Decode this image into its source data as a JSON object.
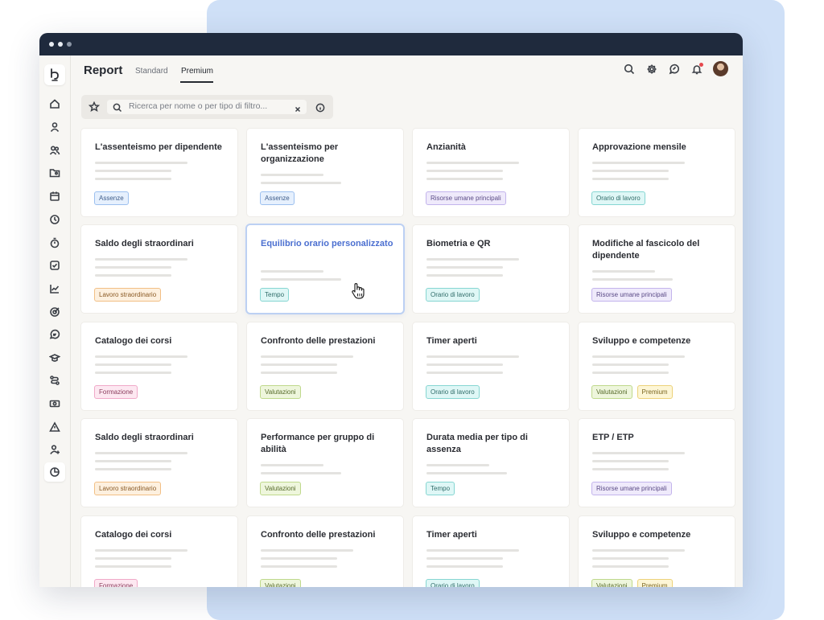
{
  "header": {
    "title": "Report",
    "tabs": [
      {
        "label": "Standard",
        "active": false
      },
      {
        "label": "Premium",
        "active": true
      }
    ]
  },
  "search": {
    "placeholder": "Ricerca per nome o per tipo di filtro..."
  },
  "icons": {
    "header": [
      "search-icon",
      "gear-icon",
      "chat-icon",
      "bell-icon"
    ],
    "sidebar": [
      "home-icon",
      "user-icon",
      "users-icon",
      "folder-user-icon",
      "calendar-icon",
      "clock-icon",
      "stopwatch-icon",
      "check-square-icon",
      "chart-icon",
      "target-icon",
      "chat-bubble-icon",
      "graduation-icon",
      "route-icon",
      "money-icon",
      "alert-icon",
      "user-plus-icon",
      "pie-chart-icon"
    ]
  },
  "colors": {
    "titlebar": "#1f2a3d",
    "background_panel": "#cfe0f7",
    "selected_title": "#4b6fd0"
  },
  "cards": [
    {
      "title": "L'assenteismo per dipendente",
      "tags": [
        {
          "label": "Assenze",
          "color": "blue"
        }
      ]
    },
    {
      "title": "L'assenteismo per organizzazione",
      "tags": [
        {
          "label": "Assenze",
          "color": "blue"
        }
      ]
    },
    {
      "title": "Anzianità",
      "tags": [
        {
          "label": "Risorse umane principali",
          "color": "purple"
        }
      ]
    },
    {
      "title": "Approvazione mensile",
      "tags": [
        {
          "label": "Orario di lavoro",
          "color": "teal"
        }
      ]
    },
    {
      "title": "Saldo degli straordinari",
      "tags": [
        {
          "label": "Lavoro straordinario",
          "color": "orange"
        }
      ]
    },
    {
      "title": "Equilibrio orario personalizzato",
      "tags": [
        {
          "label": "Tempo",
          "color": "teal"
        }
      ],
      "selected": true
    },
    {
      "title": "Biometria e QR",
      "tags": [
        {
          "label": "Orario di lavoro",
          "color": "teal"
        }
      ]
    },
    {
      "title": "Modifiche al fascicolo del dipendente",
      "tags": [
        {
          "label": "Risorse umane principali",
          "color": "purple"
        }
      ]
    },
    {
      "title": "Catalogo dei corsi",
      "tags": [
        {
          "label": "Formazione",
          "color": "pink"
        }
      ]
    },
    {
      "title": "Confronto delle prestazioni",
      "tags": [
        {
          "label": "Valutazioni",
          "color": "green"
        }
      ]
    },
    {
      "title": "Timer aperti",
      "tags": [
        {
          "label": "Orario di lavoro",
          "color": "teal"
        }
      ]
    },
    {
      "title": "Sviluppo e competenze",
      "tags": [
        {
          "label": "Valutazioni",
          "color": "green"
        },
        {
          "label": "Premium",
          "color": "yellow"
        }
      ]
    },
    {
      "title": "Saldo degli straordinari",
      "tags": [
        {
          "label": "Lavoro straordinario",
          "color": "orange"
        }
      ]
    },
    {
      "title": "Performance per gruppo di abilità",
      "tags": [
        {
          "label": "Valutazioni",
          "color": "green"
        }
      ]
    },
    {
      "title": "Durata media per tipo di assenza",
      "tags": [
        {
          "label": "Tempo",
          "color": "teal"
        }
      ]
    },
    {
      "title": "ETP / ETP",
      "tags": [
        {
          "label": "Risorse umane principali",
          "color": "purple"
        }
      ]
    },
    {
      "title": "Catalogo dei corsi",
      "tags": [
        {
          "label": "Formazione",
          "color": "pink"
        }
      ]
    },
    {
      "title": "Confronto delle prestazioni",
      "tags": [
        {
          "label": "Valutazioni",
          "color": "green"
        }
      ]
    },
    {
      "title": "Timer aperti",
      "tags": [
        {
          "label": "Orario di lavoro",
          "color": "teal"
        }
      ]
    },
    {
      "title": "Sviluppo e competenze",
      "tags": [
        {
          "label": "Valutazioni",
          "color": "green"
        },
        {
          "label": "Premium",
          "color": "yellow"
        }
      ]
    }
  ]
}
